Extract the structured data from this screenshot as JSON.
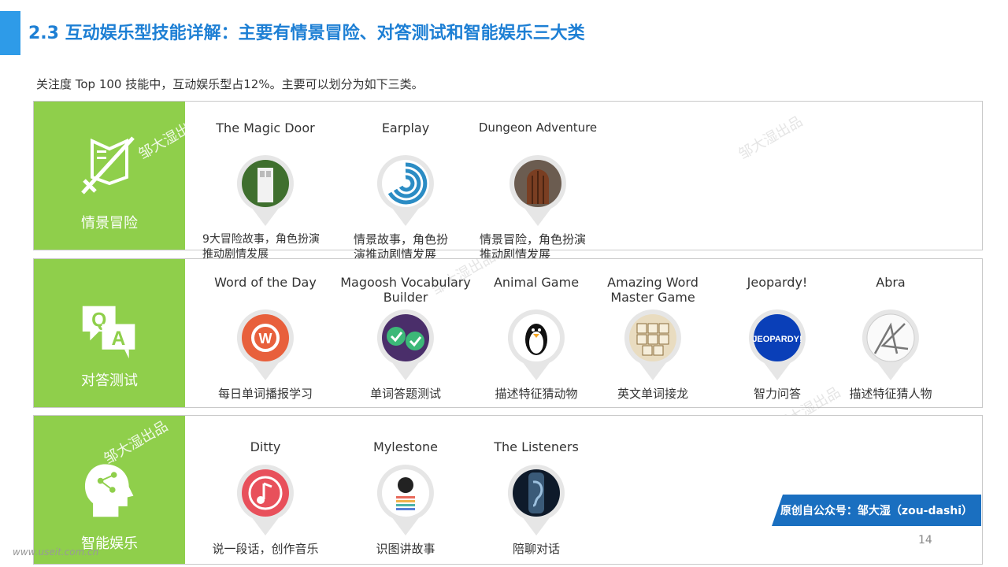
{
  "header": {
    "title": "2.3 互动娱乐型技能详解：主要有情景冒险、对答测试和智能娱乐三大类",
    "subtitle": "关注度 Top 100 技能中，互动娱乐型占12%。主要可以划分为如下三类。"
  },
  "colors": {
    "accent": "#2e9be8",
    "side": "#8fcf4b",
    "tag": "#1a6fc0"
  },
  "categories": [
    {
      "label": "情景冒险",
      "icon": "book-sword-icon",
      "skills": [
        {
          "name": "The Magic Door",
          "desc": "9大冒险故事，角色扮演推动剧情发展",
          "icon": "magic-door-icon"
        },
        {
          "name": "Earplay",
          "desc": "情景故事，角色扮演推动剧情发展",
          "icon": "earplay-icon"
        },
        {
          "name": "Dungeon Adventure",
          "desc": "情景冒险，角色扮演推动剧情发展",
          "icon": "dungeon-door-icon"
        }
      ]
    },
    {
      "label": "对答测试",
      "icon": "qa-icon",
      "skills": [
        {
          "name": "Word of the Day",
          "desc": "每日单词播报学习",
          "icon": "word-of-day-icon"
        },
        {
          "name": "Magoosh Vocabulary Builder",
          "desc": "单词答题测试",
          "icon": "double-check-icon"
        },
        {
          "name": "Animal Game",
          "desc": "描述特征猜动物",
          "icon": "penguin-icon"
        },
        {
          "name": "Amazing Word Master Game",
          "desc": "英文单词接龙",
          "icon": "word-tiles-icon"
        },
        {
          "name": "Jeopardy!",
          "desc": "智力问答",
          "icon": "jeopardy-icon"
        },
        {
          "name": "Abra",
          "desc": "描述特征猜人物",
          "icon": "abra-icon"
        }
      ]
    },
    {
      "label": "智能娱乐",
      "icon": "head-share-icon",
      "skills": [
        {
          "name": "Ditty",
          "desc": "说一段话，创作音乐",
          "icon": "music-note-icon"
        },
        {
          "name": "Mylestone",
          "desc": "识图讲故事",
          "icon": "mylestone-icon"
        },
        {
          "name": "The Listeners",
          "desc": "陪聊对话",
          "icon": "ear-icon"
        }
      ]
    }
  ],
  "watermark": "邹大湿出品",
  "source_tag": "原创自公众号：邹大湿（zou-dashi）",
  "page_number": "14",
  "footer_url": "www.useit.com.cn"
}
